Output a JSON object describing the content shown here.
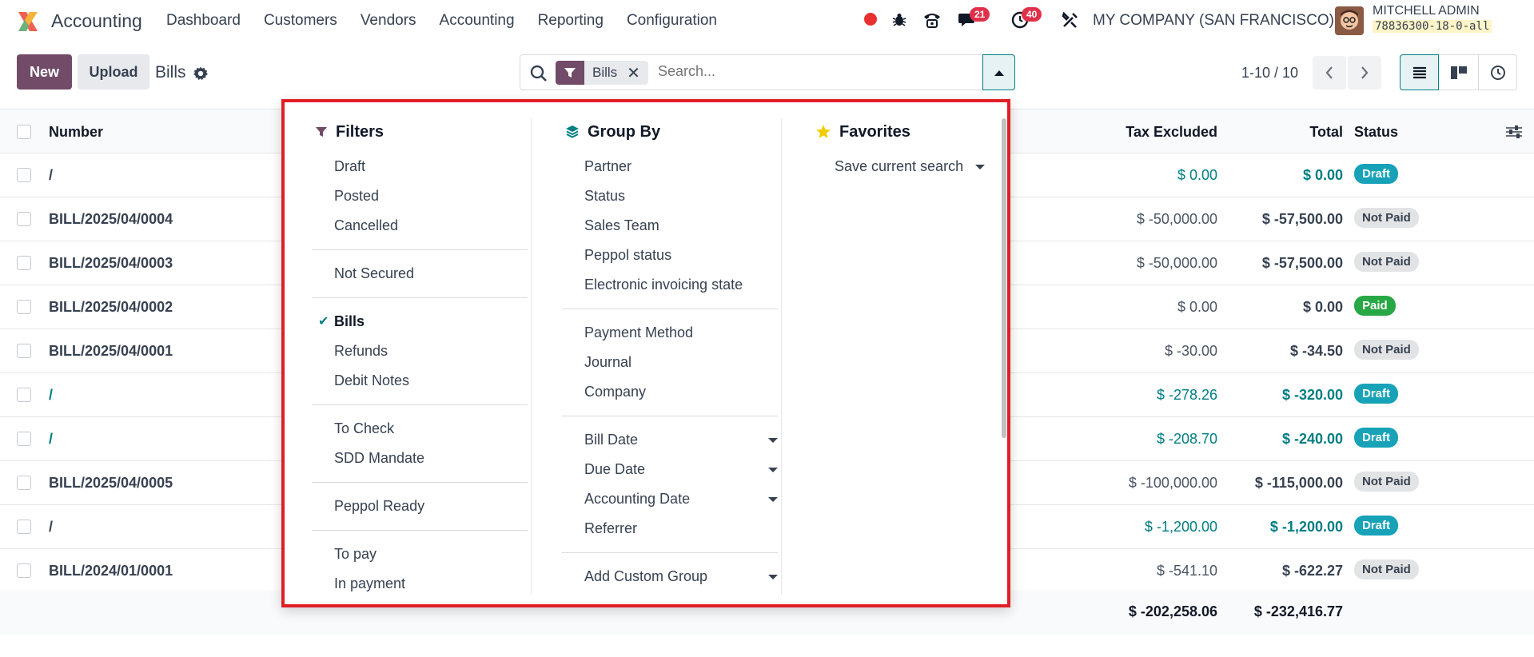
{
  "navbar": {
    "app_name": "Accounting",
    "menu": [
      "Dashboard",
      "Customers",
      "Vendors",
      "Accounting",
      "Reporting",
      "Configuration"
    ],
    "chat_badge": "21",
    "activity_badge": "40",
    "company": "MY COMPANY (SAN FRANCISCO)",
    "user_name": "MITCHELL ADMIN",
    "db_name": "78836300-18-0-all"
  },
  "control": {
    "new_label": "New",
    "upload_label": "Upload",
    "title": "Bills",
    "facet_label": "Bills",
    "search_placeholder": "Search...",
    "pager": "1-10 / 10"
  },
  "list": {
    "headers": {
      "number": "Number",
      "tax_excluded": "Tax Excluded",
      "total": "Total",
      "status": "Status"
    },
    "rows": [
      {
        "number": "/",
        "tax": "$ 0.00",
        "total": "$ 0.00",
        "status": "Draft"
      },
      {
        "number": "BILL/2025/04/0004",
        "tax": "$ -50,000.00",
        "total": "$ -57,500.00",
        "status": "Not Paid"
      },
      {
        "number": "BILL/2025/04/0003",
        "tax": "$ -50,000.00",
        "total": "$ -57,500.00",
        "status": "Not Paid"
      },
      {
        "number": "BILL/2025/04/0002",
        "tax": "$ 0.00",
        "total": "$ 0.00",
        "status": "Paid"
      },
      {
        "number": "BILL/2025/04/0001",
        "tax": "$ -30.00",
        "total": "$ -34.50",
        "status": "Not Paid"
      },
      {
        "number": "/",
        "tax": "$ -278.26",
        "total": "$ -320.00",
        "status": "Draft"
      },
      {
        "number": "/",
        "tax": "$ -208.70",
        "total": "$ -240.00",
        "status": "Draft"
      },
      {
        "number": "BILL/2025/04/0005",
        "tax": "$ -100,000.00",
        "total": "$ -115,000.00",
        "status": "Not Paid"
      },
      {
        "number": "/",
        "tax": "$ -1,200.00",
        "total": "$ -1,200.00",
        "status": "Draft"
      },
      {
        "number": "BILL/2024/01/0001",
        "tax": "$ -541.10",
        "total": "$ -622.27",
        "status": "Not Paid"
      }
    ],
    "sum_tax": "$ -202,258.06",
    "sum_total": "$ -232,416.77"
  },
  "dropdown": {
    "filters": {
      "title": "Filters",
      "groups": [
        [
          "Draft",
          "Posted",
          "Cancelled"
        ],
        [
          "Not Secured"
        ],
        [
          "Bills",
          "Refunds",
          "Debit Notes"
        ],
        [
          "To Check",
          "SDD Mandate"
        ],
        [
          "Peppol Ready"
        ],
        [
          "To pay",
          "In payment"
        ]
      ],
      "selected": "Bills"
    },
    "group_by": {
      "title": "Group By",
      "groups": [
        [
          "Partner",
          "Status",
          "Sales Team",
          "Peppol status",
          "Electronic invoicing state"
        ],
        [
          "Payment Method",
          "Journal",
          "Company"
        ],
        [
          "Bill Date",
          "Due Date",
          "Accounting Date",
          "Referrer"
        ],
        [
          "Add Custom Group"
        ]
      ],
      "carets": [
        "Bill Date",
        "Due Date",
        "Accounting Date",
        "Add Custom Group"
      ]
    },
    "favorites": {
      "title": "Favorites",
      "save_label": "Save current search"
    }
  },
  "colors": {
    "brand": "#714b67",
    "teal": "#017e84",
    "highlight_border": "#e01e26",
    "badge_red": "#e0314b"
  }
}
